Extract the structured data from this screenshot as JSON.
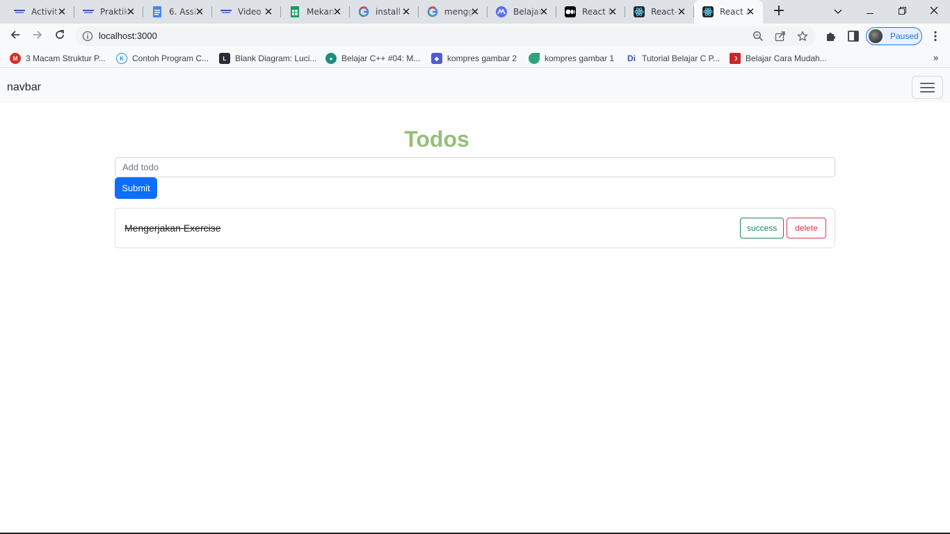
{
  "browser": {
    "tabs": [
      {
        "title": "Activit",
        "favicon": "pens-icon",
        "color": "#3a56a8"
      },
      {
        "title": "Praktik",
        "favicon": "pens-icon",
        "color": "#3a56a8"
      },
      {
        "title": "6. Assi",
        "favicon": "docs-icon",
        "color": "#4285f4"
      },
      {
        "title": "Video",
        "favicon": "pens-icon",
        "color": "#3a56a8"
      },
      {
        "title": "Mekan",
        "favicon": "sheets-icon",
        "color": "#0f9d58"
      },
      {
        "title": "install",
        "favicon": "google-icon",
        "color": "#4285f4"
      },
      {
        "title": "mengg",
        "favicon": "google-icon",
        "color": "#4285f4"
      },
      {
        "title": "Belajar",
        "favicon": "dicoding-icon",
        "color": "#5b6ef5"
      },
      {
        "title": "React b",
        "favicon": "medium-icon",
        "color": "#000000"
      },
      {
        "title": "React-",
        "favicon": "react-icon",
        "color": "#23272f"
      },
      {
        "title": "React A",
        "favicon": "react-icon",
        "color": "#23272f",
        "active": true
      }
    ],
    "url": "localhost:3000",
    "profile_status": "Paused",
    "bookmarks": [
      {
        "label": "3 Macam Struktur P...",
        "color": "#d93025"
      },
      {
        "label": "Contoh Program C...",
        "color": "#1e88e5"
      },
      {
        "label": "Blank Diagram: Luci...",
        "color": "#282c34"
      },
      {
        "label": "Belajar C++ #04: M...",
        "color": "#1a8f7a"
      },
      {
        "label": "kompres gambar 2",
        "color": "#4f5bd5"
      },
      {
        "label": "kompres gambar 1",
        "color": "#2ea37c"
      },
      {
        "label": "Tutorial Belajar C P...",
        "color": "#3f51b5"
      },
      {
        "label": "Belajar Cara Mudah...",
        "color": "#c62828"
      }
    ]
  },
  "app": {
    "navbar_brand": "navbar",
    "title": "Todos",
    "input_placeholder": "Add todo",
    "input_value": "",
    "submit_label": "Submit",
    "todos": [
      {
        "text": "Mengerjakan Exercise",
        "completed": true,
        "success_label": "success",
        "delete_label": "delete"
      }
    ]
  }
}
